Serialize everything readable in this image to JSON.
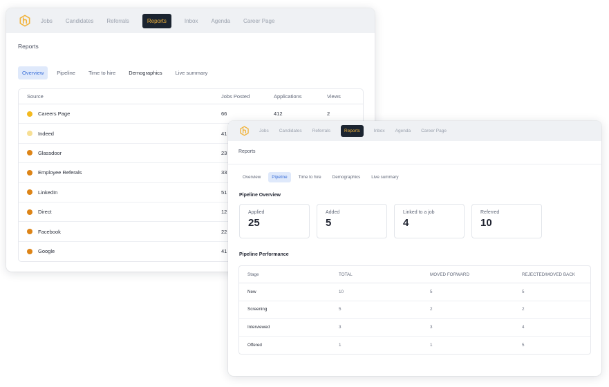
{
  "nav": [
    "Jobs",
    "Candidates",
    "Referrals",
    "Reports",
    "Inbox",
    "Agenda",
    "Career Page"
  ],
  "nav_active": "Reports",
  "page_title": "Reports",
  "tabs": [
    "Overview",
    "Pipeline",
    "Time to hire",
    "Demographics",
    "Live summary"
  ],
  "colors": {
    "nav_bg": "#eff1f4",
    "active_nav": "#1b2430",
    "active_nav_text": "#f1b33b",
    "active_tab_bg": "#dfe9fb",
    "active_tab_text": "#3a6fd8",
    "logo": "#f1b33b"
  },
  "overview": {
    "active_tab": "Overview",
    "columns": {
      "source": "Source",
      "jobs": "Jobs Posted",
      "apps": "Applications",
      "views": "Views"
    },
    "rows": [
      {
        "source": "Careers Page",
        "jobs": "66",
        "apps": "412",
        "views": "2",
        "color": "#f3b91f"
      },
      {
        "source": "Indeed",
        "jobs": "41",
        "apps": "",
        "views": "",
        "color": "#f7df94"
      },
      {
        "source": "Glassdoor",
        "jobs": "23",
        "apps": "",
        "views": "",
        "color": "#dd8417"
      },
      {
        "source": "Employee Referals",
        "jobs": "33",
        "apps": "",
        "views": "",
        "color": "#dd8417"
      },
      {
        "source": "LinkedIn",
        "jobs": "51",
        "apps": "",
        "views": "",
        "color": "#dd8417"
      },
      {
        "source": "Direct",
        "jobs": "12",
        "apps": "",
        "views": "",
        "color": "#dd8417"
      },
      {
        "source": "Facebook",
        "jobs": "22",
        "apps": "",
        "views": "",
        "color": "#dd8417"
      },
      {
        "source": "Google",
        "jobs": "41",
        "apps": "",
        "views": "",
        "color": "#dd8417"
      }
    ]
  },
  "pipeline": {
    "active_tab": "Pipeline",
    "overview_title": "Pipeline Overview",
    "stats": [
      {
        "label": "Applied",
        "value": "25"
      },
      {
        "label": "Added",
        "value": "5"
      },
      {
        "label": "Linked to a job",
        "value": "4"
      },
      {
        "label": "Referred",
        "value": "10"
      }
    ],
    "performance_title": "Pipeline Performance",
    "columns": {
      "stage": "Stage",
      "total": "TOTAL",
      "fwd": "MOVED FORWARD",
      "rej": "REJECTED/MOVED BACK"
    },
    "rows": [
      {
        "stage": "New",
        "total": "10",
        "fwd": "5",
        "rej": "5"
      },
      {
        "stage": "Screening",
        "total": "5",
        "fwd": "2",
        "rej": "2"
      },
      {
        "stage": "Interviewed",
        "total": "3",
        "fwd": "3",
        "rej": "4"
      },
      {
        "stage": "Offered",
        "total": "1",
        "fwd": "1",
        "rej": "5"
      }
    ]
  }
}
